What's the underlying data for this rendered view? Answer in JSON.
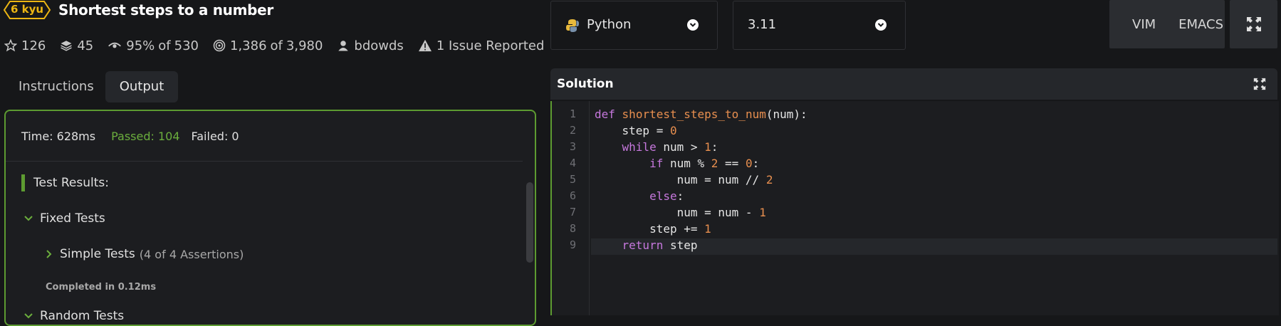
{
  "kata": {
    "rank": "6 kyu",
    "title": "Shortest steps to a number",
    "stats": {
      "stars": "126",
      "collections": "45",
      "satisfaction": "95%",
      "satisfaction_of": "of",
      "satisfaction_votes": "530",
      "completed": "1,386",
      "completed_of": "of",
      "attempts": "3,980",
      "author": "bdowds",
      "issues": "1 Issue Reported"
    }
  },
  "tabs": {
    "instructions": "Instructions",
    "output": "Output"
  },
  "output": {
    "time": "Time: 628ms",
    "passed": "Passed: 104",
    "failed": "Failed: 0",
    "results_heading": "Test Results:",
    "fixed_group": "Fixed Tests",
    "simple_group": "Simple Tests",
    "simple_assertions": "(4 of 4 Assertions)",
    "completed_in": "Completed in 0.12ms",
    "random_group": "Random Tests"
  },
  "toolbar": {
    "language": "Python",
    "version": "3.11",
    "vim": "VIM",
    "emacs": "EMACS"
  },
  "solution": {
    "title": "Solution",
    "line_numbers": [
      "1",
      "2",
      "3",
      "4",
      "5",
      "6",
      "7",
      "8",
      "9"
    ]
  },
  "colors": {
    "accent_green": "#5d9b31",
    "rank_yellow": "#ecb613",
    "background": "#161719"
  },
  "icons": {
    "star": "star-icon",
    "collections": "layers-icon",
    "satisfaction": "eye-icon",
    "completed": "target-icon",
    "author": "user-icon",
    "issues": "warning-icon",
    "language": "python-logo-icon",
    "fullscreen": "fullscreen-icon"
  }
}
